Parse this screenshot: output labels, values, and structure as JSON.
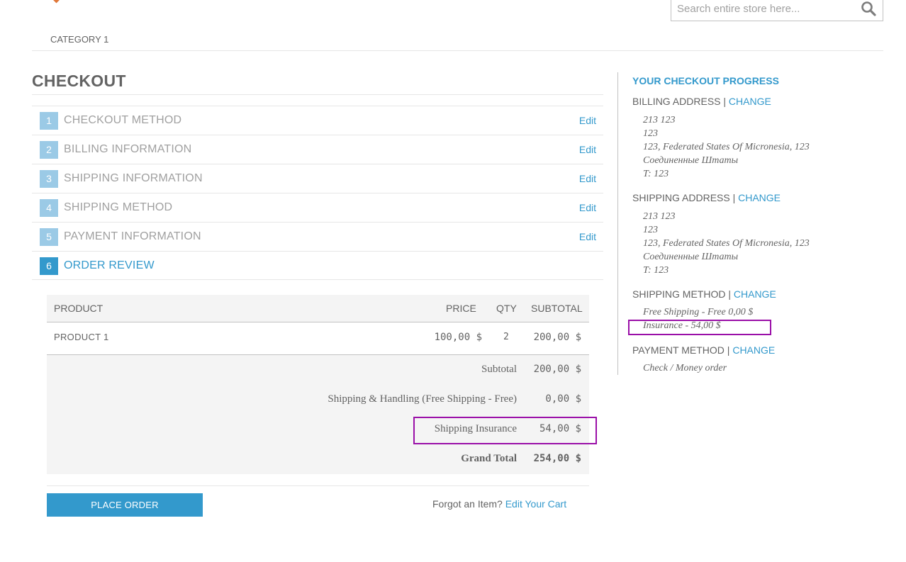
{
  "header": {
    "search_placeholder": "Search entire store here..."
  },
  "nav": {
    "items": [
      "CATEGORY 1"
    ]
  },
  "page": {
    "title": "CHECKOUT"
  },
  "steps": [
    {
      "num": "1",
      "label": "CHECKOUT METHOD",
      "edit": "Edit"
    },
    {
      "num": "2",
      "label": "BILLING INFORMATION",
      "edit": "Edit"
    },
    {
      "num": "3",
      "label": "SHIPPING INFORMATION",
      "edit": "Edit"
    },
    {
      "num": "4",
      "label": "SHIPPING METHOD",
      "edit": "Edit"
    },
    {
      "num": "5",
      "label": "PAYMENT INFORMATION",
      "edit": "Edit"
    },
    {
      "num": "6",
      "label": "ORDER REVIEW"
    }
  ],
  "review": {
    "columns": {
      "product": "PRODUCT",
      "price": "PRICE",
      "qty": "QTY",
      "subtotal": "SUBTOTAL"
    },
    "items": [
      {
        "name": "PRODUCT 1",
        "price": "100,00 $",
        "qty": "2",
        "subtotal": "200,00 $"
      }
    ],
    "totals": [
      {
        "label": "Subtotal",
        "value": "200,00 $"
      },
      {
        "label": "Shipping & Handling (Free Shipping - Free)",
        "value": "0,00 $"
      },
      {
        "label": "Shipping Insurance",
        "value": "54,00 $"
      },
      {
        "label": "Grand Total",
        "value": "254,00 $"
      }
    ],
    "place_order": "PLACE ORDER",
    "forgot_text": "Forgot an Item?",
    "edit_cart": "Edit Your Cart"
  },
  "sidebar": {
    "title": "YOUR CHECKOUT PROGRESS",
    "separator": "|",
    "change": "CHANGE",
    "billing": {
      "label": "BILLING ADDRESS",
      "lines": [
        "213 123",
        "123",
        "123, Federated States Of Micronesia, 123",
        "Соединенные Штаты",
        "T: 123"
      ]
    },
    "shipping": {
      "label": "SHIPPING ADDRESS",
      "lines": [
        "213 123",
        "123",
        "123, Federated States Of Micronesia, 123",
        "Соединенные Штаты",
        "T: 123"
      ]
    },
    "shipping_method": {
      "label": "SHIPPING METHOD",
      "lines": [
        "Free Shipping - Free 0,00 $",
        "Insurance - 54,00 $"
      ]
    },
    "payment_method": {
      "label": "PAYMENT METHOD",
      "lines": [
        "Check / Money order"
      ]
    }
  },
  "colors": {
    "accent": "#3399cc",
    "step_inactive": "#9bcae6",
    "highlight": "#9a0fa8",
    "text": "#636363"
  }
}
